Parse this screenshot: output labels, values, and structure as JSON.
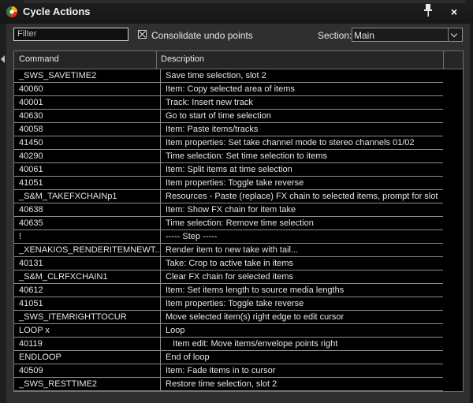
{
  "window": {
    "title": "Cycle Actions",
    "close_glyph": "×"
  },
  "toolbar": {
    "filter_placeholder": "Filter",
    "consolidate_label": "Consolidate undo points",
    "consolidate_checked": true,
    "section_label": "Section:",
    "section_value": "Main"
  },
  "table": {
    "headers": {
      "command": "Command",
      "description": "Description"
    },
    "rows": [
      {
        "command": "_SWS_SAVETIME2",
        "description": "Save time selection, slot 2"
      },
      {
        "command": "40060",
        "description": "Item: Copy selected area of items"
      },
      {
        "command": "40001",
        "description": "Track: Insert new track"
      },
      {
        "command": "40630",
        "description": "Go to start of time selection"
      },
      {
        "command": "40058",
        "description": "Item: Paste items/tracks"
      },
      {
        "command": "41450",
        "description": "Item properties: Set take channel mode to stereo channels 01/02"
      },
      {
        "command": "40290",
        "description": "Time selection: Set time selection to items"
      },
      {
        "command": "40061",
        "description": "Item: Split items at time selection"
      },
      {
        "command": "41051",
        "description": "Item properties: Toggle take reverse"
      },
      {
        "command": "_S&M_TAKEFXCHAINp1",
        "description": "Resources - Paste (replace) FX chain to selected items, prompt for slot"
      },
      {
        "command": "40638",
        "description": "Item: Show FX chain for item take"
      },
      {
        "command": "40635",
        "description": "Time selection: Remove time selection"
      },
      {
        "command": "!",
        "description": "----- Step -----"
      },
      {
        "command": "_XENAKIOS_RENDERITEMNEWT...",
        "description": "Render item to new take with tail..."
      },
      {
        "command": "40131",
        "description": "Take: Crop to active take in items"
      },
      {
        "command": "_S&M_CLRFXCHAIN1",
        "description": "Clear FX chain for selected items"
      },
      {
        "command": "40612",
        "description": "Item: Set items length to source media lengths"
      },
      {
        "command": "41051",
        "description": "Item properties: Toggle take reverse"
      },
      {
        "command": "_SWS_ITEMRIGHTTOCUR",
        "description": "Move selected item(s) right edge to edit cursor"
      },
      {
        "command": "LOOP x",
        "description": "Loop"
      },
      {
        "command": "40119",
        "description": "   Item edit: Move items/envelope points right"
      },
      {
        "command": "ENDLOOP",
        "description": "End of loop"
      },
      {
        "command": "40509",
        "description": "Item: Fade items in to cursor"
      },
      {
        "command": "_SWS_RESTTIME2",
        "description": "Restore time selection, slot 2"
      }
    ]
  }
}
